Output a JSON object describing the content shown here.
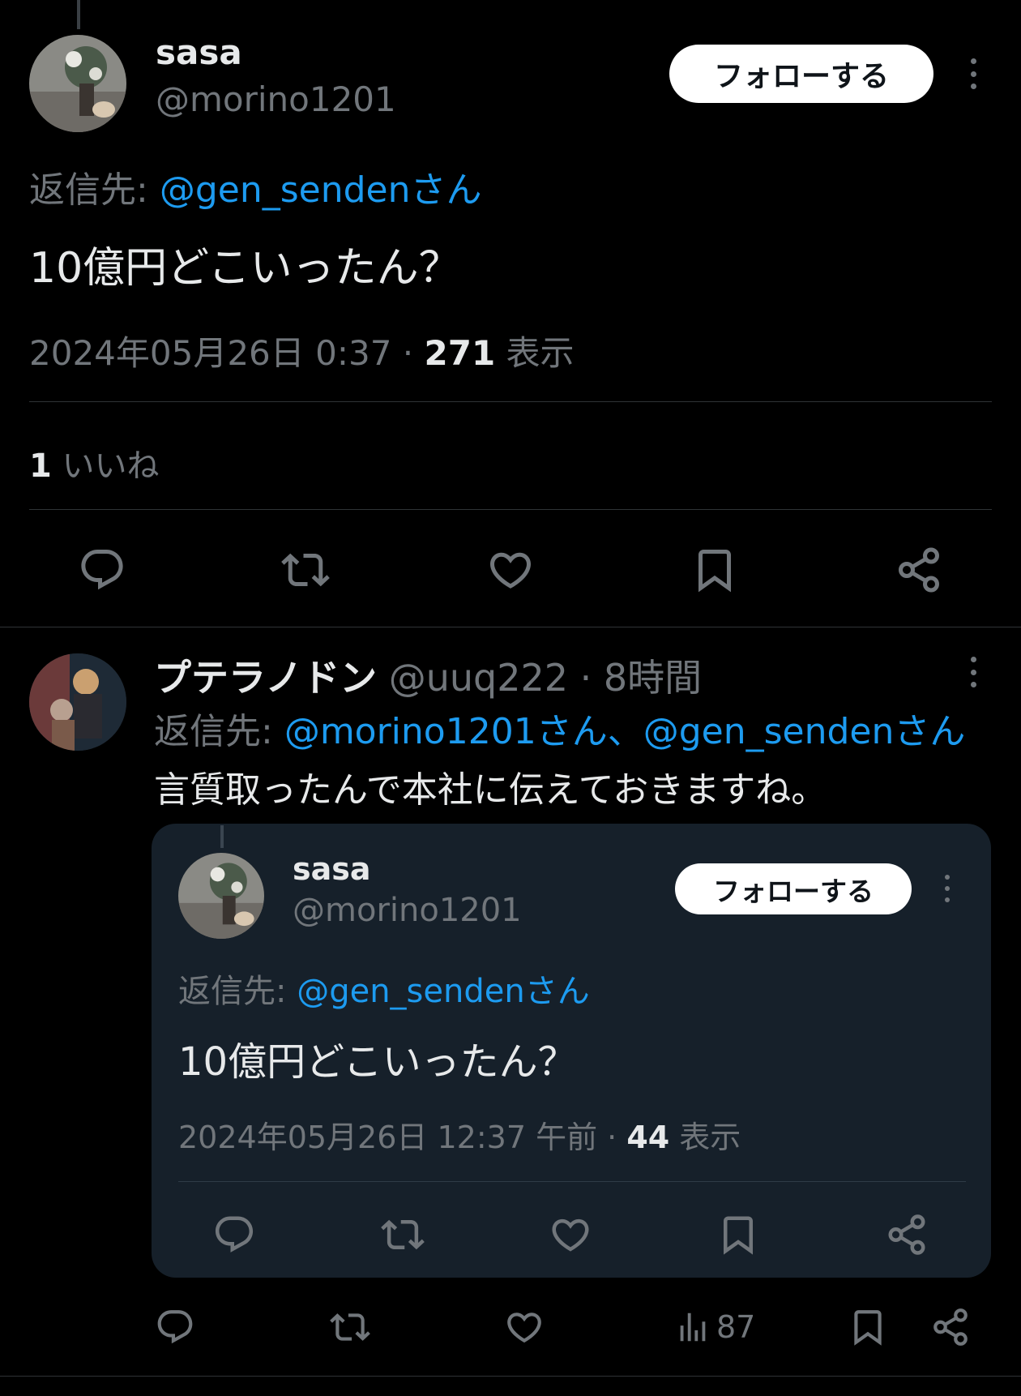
{
  "main_tweet": {
    "display_name": "sasa",
    "handle": "@morino1201",
    "follow_label": "フォローする",
    "reply_to_prefix": "返信先: ",
    "reply_to_handle": "@gen_sendenさん",
    "text": "10億円どこいったん？",
    "timestamp": "2024年05月26日 0:37 · ",
    "views_count": "271",
    "views_label": " 表示",
    "likes_count": "1",
    "likes_label": " いいね"
  },
  "reply": {
    "display_name": "プテラノドン",
    "handle": "@uuq222",
    "time": " · 8時間",
    "reply_to_prefix": "返信先: ",
    "reply_to_handles": "@morino1201さん、@gen_sendenさん",
    "text": "言質取ったんで本社に伝えておきますね。",
    "views": "87"
  },
  "quoted": {
    "display_name": "sasa",
    "handle": "@morino1201",
    "follow_label": "フォローする",
    "reply_to_prefix": "返信先: ",
    "reply_to_handle": "@gen_sendenさん",
    "text": "10億円どこいったん？",
    "timestamp": "2024年05月26日 12:37 午前 · ",
    "views_count": "44",
    "views_label": " 表示"
  },
  "colors": {
    "background": "#000000",
    "accent": "#1d9bf0",
    "card": "#16202a",
    "muted": "#71767b"
  },
  "icons": [
    "reply-icon",
    "retweet-icon",
    "like-icon",
    "bookmark-icon",
    "share-icon",
    "views-icon",
    "more-icon"
  ]
}
